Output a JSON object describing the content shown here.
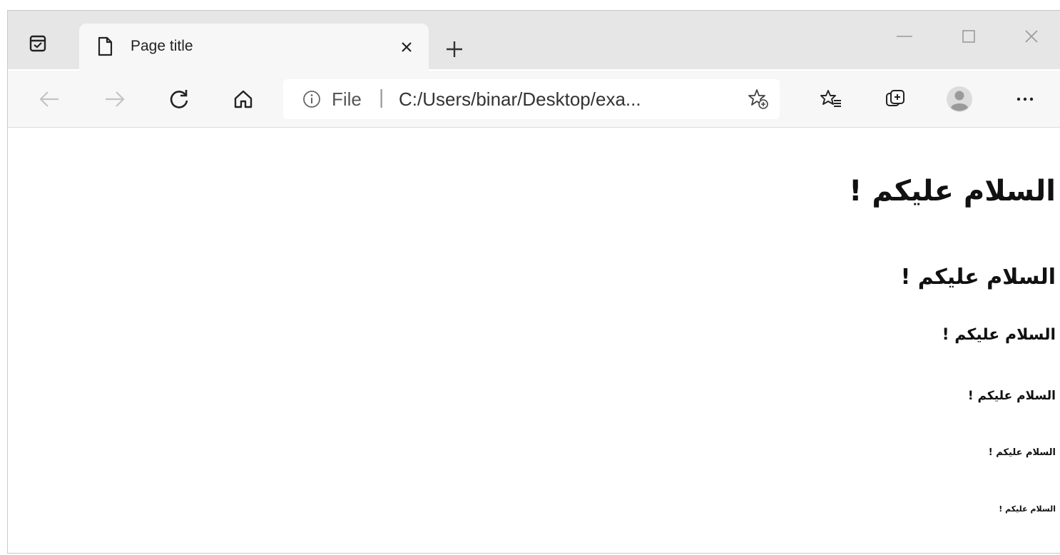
{
  "browser": {
    "tab": {
      "title": "Page title",
      "page_icon": "page-icon",
      "close_icon": "close-icon"
    },
    "new_tab_icon": "plus-icon",
    "window_controls": [
      "minimize-icon",
      "maximize-icon",
      "close-icon"
    ],
    "toolbar": {
      "back_icon": "arrow-left-icon",
      "forward_icon": "arrow-right-icon",
      "refresh_icon": "refresh-icon",
      "home_icon": "home-icon",
      "address": {
        "scheme_label": "File",
        "separator": "|",
        "url": "C:/Users/binar/Desktop/exa..."
      },
      "add_favorite_icon": "star-add-icon",
      "favorites_icon": "favorites-list-icon",
      "collections_icon": "collections-icon",
      "profile_icon": "avatar-icon",
      "menu_icon": "more-icon"
    }
  },
  "page": {
    "headings": [
      "السلام عليكم !",
      "السلام عليكم !",
      "السلام عليكم !",
      "السلام عليكم !",
      "السلام عليكم !",
      "السلام عليكم !"
    ]
  }
}
